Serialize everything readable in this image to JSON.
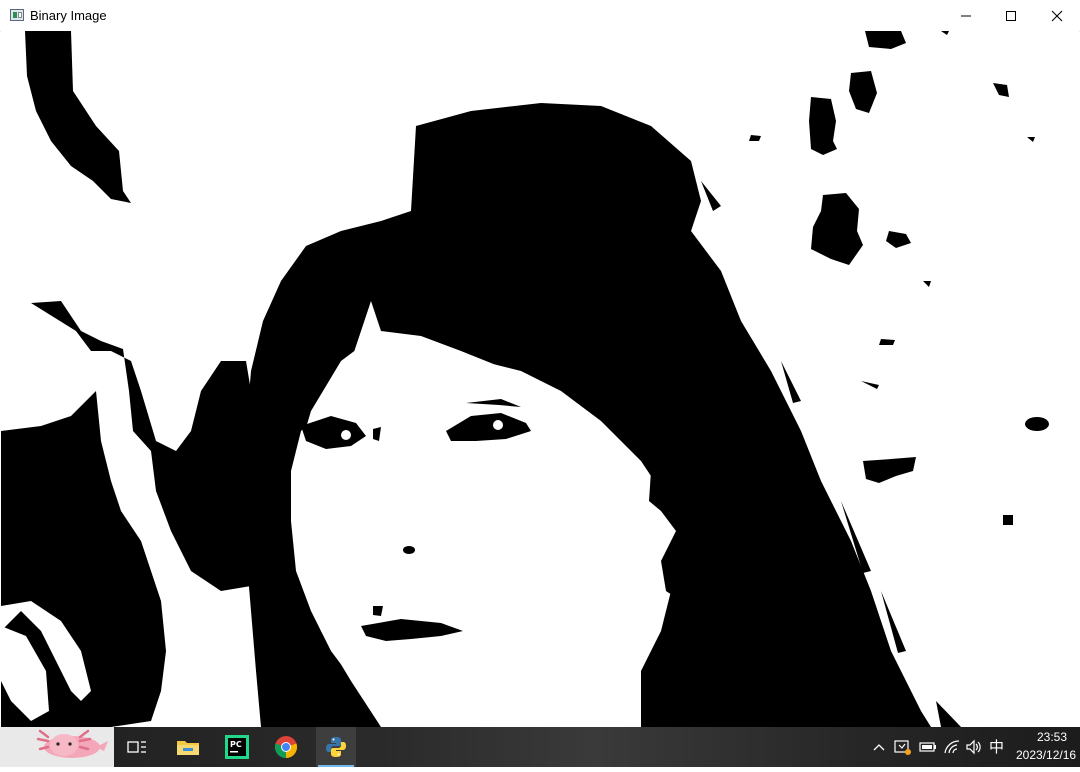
{
  "window": {
    "title": "Binary Image",
    "controls": [
      "minimize",
      "maximize",
      "close"
    ]
  },
  "image": {
    "mode": "binary",
    "foreground": "#000000",
    "background": "#ffffff"
  },
  "taskbar": {
    "start_icon": "axolotl-icon",
    "pinned": [
      {
        "name": "task-view-icon",
        "active": false
      },
      {
        "name": "file-explorer-icon",
        "active": false
      },
      {
        "name": "pycharm-icon",
        "active": false
      },
      {
        "name": "chrome-icon",
        "active": false
      },
      {
        "name": "python-icon",
        "active": true
      }
    ],
    "tray": {
      "ime_label": "中",
      "time": "23:53",
      "date": "2023/12/16"
    },
    "accent_color": "#76b9ed"
  }
}
